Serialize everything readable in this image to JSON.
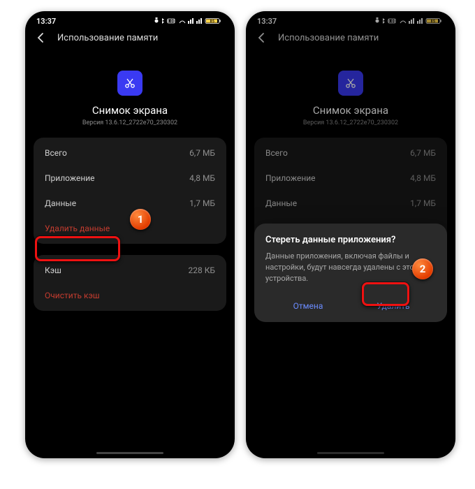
{
  "status": {
    "time": "13:37",
    "icons_aria": "alarm bluetooth dnd wifi signal signal battery-85"
  },
  "header": {
    "title": "Использование памяти"
  },
  "app": {
    "name": "Снимок экрана",
    "version": "Версия 13.6.12_2722e70_230302",
    "icon_name": "scissors-icon"
  },
  "storage": {
    "rows": [
      {
        "label": "Всего",
        "value": "6,7 МБ"
      },
      {
        "label": "Приложение",
        "value": "4,8 МБ"
      },
      {
        "label": "Данные",
        "value": "1,7 МБ"
      }
    ],
    "clear_data_label": "Удалить данные"
  },
  "cache": {
    "label": "Кэш",
    "value": "228 КБ",
    "clear_cache_label": "Очистить кэш"
  },
  "dialog": {
    "title": "Стереть данные приложения?",
    "body": "Данные приложения, включая файлы и настройки, будут навсегда удалены с этого устройства.",
    "cancel": "Отмена",
    "confirm": "Удалить"
  },
  "markers": {
    "one": "1",
    "two": "2"
  }
}
